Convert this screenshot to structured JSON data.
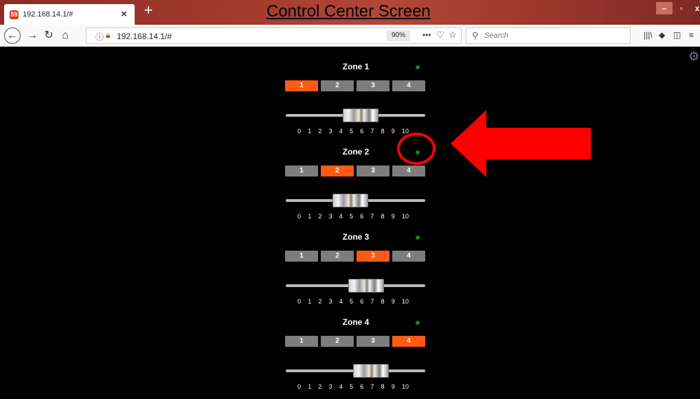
{
  "window": {
    "app_title": "Control Center Screen",
    "tab_title": "192.168.14.1/#",
    "favicon_text": "59",
    "new_tab_icon": "plus-icon"
  },
  "navbar": {
    "url": "192.168.14.1/#",
    "zoom": "90%",
    "search_placeholder": "Search"
  },
  "zones": [
    {
      "title": "Zone 1",
      "buttons": [
        "1",
        "2",
        "3",
        "4"
      ],
      "active": 1,
      "slider_value": 5.5,
      "indicator_color": "#1a8a1a"
    },
    {
      "title": "Zone 2",
      "buttons": [
        "1",
        "2",
        "3",
        "4"
      ],
      "active": 2,
      "slider_value": 4.5,
      "indicator_color": "#1a8a1a"
    },
    {
      "title": "Zone 3",
      "buttons": [
        "1",
        "2",
        "3",
        "4"
      ],
      "active": 3,
      "slider_value": 6,
      "indicator_color": "#1a8a1a"
    },
    {
      "title": "Zone 4",
      "buttons": [
        "1",
        "2",
        "3",
        "4"
      ],
      "active": 4,
      "slider_value": 6.5,
      "indicator_color": "#1a8a1a"
    }
  ],
  "slider_ticks": [
    "0",
    "1",
    "2",
    "3",
    "4",
    "5",
    "6",
    "7",
    "8",
    "9",
    "10"
  ],
  "colors": {
    "active_button": "#ff5a14",
    "inactive_button": "#7d7d7d",
    "annotation": "#ff0000"
  }
}
